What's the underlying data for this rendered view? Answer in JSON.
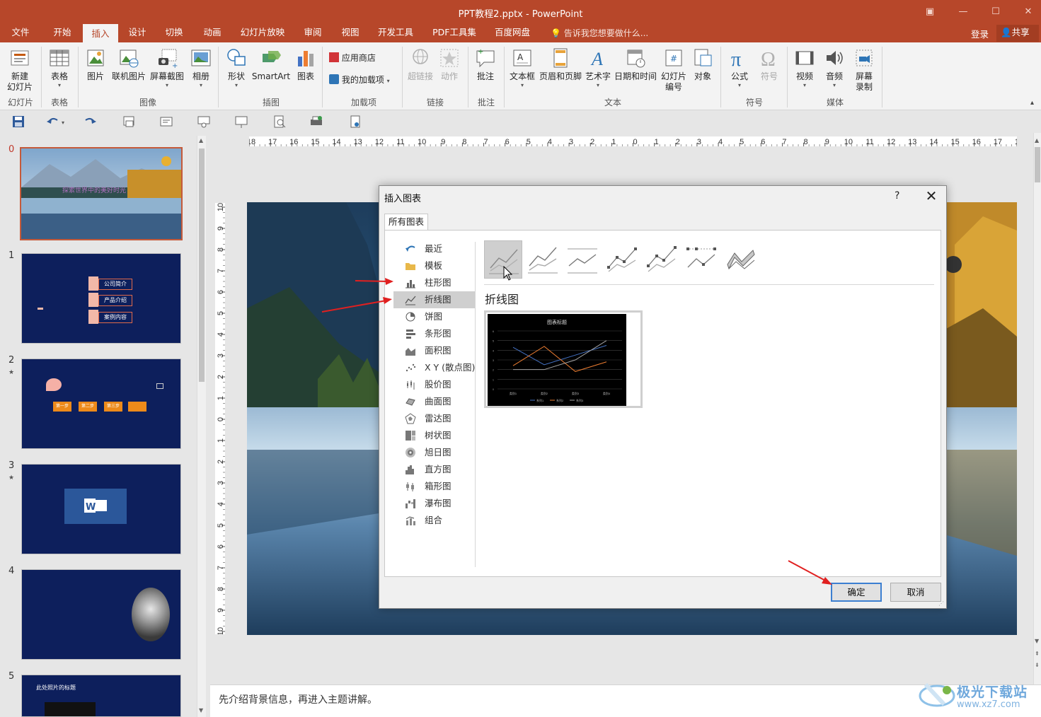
{
  "window": {
    "title": "PPT教程2.pptx - PowerPoint"
  },
  "tabs": [
    "文件",
    "开始",
    "插入",
    "设计",
    "切换",
    "动画",
    "幻灯片放映",
    "审阅",
    "视图",
    "开发工具",
    "PDF工具集",
    "百度网盘"
  ],
  "active_tab": "插入",
  "tell_me": "告诉我您想要做什么...",
  "account": {
    "login": "登录",
    "share": "共享"
  },
  "ribbon": {
    "new_slide": "新建\n幻灯片",
    "table": "表格",
    "picture": "图片",
    "online_picture": "联机图片",
    "screenshot": "屏幕截图",
    "album": "相册",
    "shapes": "形状",
    "smartart": "SmartArt",
    "chart": "图表",
    "store": "应用商店",
    "my_addins": "我的加载项",
    "hyperlink": "超链接",
    "action": "动作",
    "comment": "批注",
    "textbox": "文本框",
    "header_footer": "页眉和页脚",
    "wordart": "艺术字",
    "datetime": "日期和时间",
    "slide_number": "幻灯片\n编号",
    "object": "对象",
    "equation": "公式",
    "symbol": "符号",
    "video": "视频",
    "audio": "音频",
    "screen_record": "屏幕\n录制",
    "groups": {
      "slides": "幻灯片",
      "tables": "表格",
      "images": "图像",
      "illustrations": "插图",
      "addins": "加载项",
      "links": "链接",
      "comments": "批注",
      "text": "文本",
      "symbols": "符号",
      "media": "媒体"
    }
  },
  "ruler_h": [
    "18",
    "17",
    "16",
    "15",
    "14",
    "13",
    "12",
    "11",
    "10",
    "9",
    "8",
    "7",
    "6",
    "5",
    "4",
    "3",
    "2",
    "1",
    "0",
    "1",
    "2",
    "3",
    "4",
    "5",
    "6",
    "7",
    "8",
    "9",
    "10",
    "11",
    "12",
    "13",
    "14",
    "15",
    "16",
    "17",
    "18"
  ],
  "ruler_v": [
    "10",
    "9",
    "8",
    "7",
    "6",
    "5",
    "4",
    "3",
    "2",
    "1",
    "0",
    "1",
    "2",
    "3",
    "4",
    "5",
    "6",
    "7",
    "8",
    "9",
    "10"
  ],
  "thumbnails": [
    {
      "num": "0",
      "star": false,
      "title_text": "探索世界中的美好时光"
    },
    {
      "num": "1",
      "star": false,
      "items": [
        "公司简介",
        "产品介绍",
        "案例内容"
      ]
    },
    {
      "num": "2",
      "star": true,
      "steps": [
        "第一步",
        "第二步",
        "第三步",
        ""
      ]
    },
    {
      "num": "3",
      "star": true
    },
    {
      "num": "4",
      "star": false
    },
    {
      "num": "5",
      "star": false,
      "title_text": "此处照片的标题"
    }
  ],
  "notes": "先介绍背景信息，再进入主题讲解。",
  "dialog": {
    "title": "插入图表",
    "help": "?",
    "tab": "所有图表",
    "categories": [
      "最近",
      "模板",
      "柱形图",
      "折线图",
      "饼图",
      "条形图",
      "面积图",
      "X Y (散点图)",
      "股价图",
      "曲面图",
      "雷达图",
      "树状图",
      "旭日图",
      "直方图",
      "箱形图",
      "瀑布图",
      "组合"
    ],
    "selected_category": "折线图",
    "subtype_title": "折线图",
    "preview_title": "图表标题",
    "ok": "确定",
    "cancel": "取消"
  },
  "preview_chart": {
    "type": "line",
    "categories": [
      "类别1",
      "类别2",
      "类别3",
      "类别4"
    ],
    "series": [
      {
        "name": "系列1",
        "values": [
          4.3,
          2.5,
          3.5,
          4.5
        ],
        "color": "#4472c4"
      },
      {
        "name": "系列2",
        "values": [
          2.4,
          4.4,
          1.8,
          2.8
        ],
        "color": "#ed7d31"
      },
      {
        "name": "系列3",
        "values": [
          2.0,
          2.0,
          3.0,
          5.0
        ],
        "color": "#a5a5a5"
      }
    ],
    "ylim": [
      0,
      6
    ]
  },
  "watermark": {
    "line1": "极光下载站",
    "line2": "www.xz7.com"
  }
}
